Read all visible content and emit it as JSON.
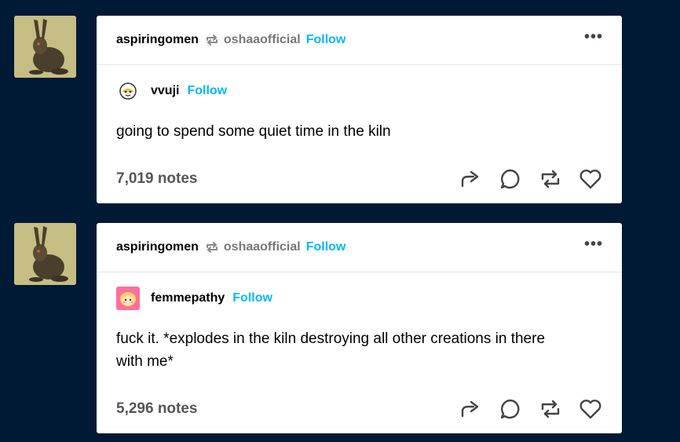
{
  "posts": [
    {
      "reblogger": "aspiringomen",
      "reblogged_from": "oshaaofficial",
      "follow_label": "Follow",
      "more_label": "•••",
      "source_user": "vvuji",
      "source_follow_label": "Follow",
      "body_lines": [
        "going to spend some quiet time in the kiln"
      ],
      "notes": "7,019 notes"
    },
    {
      "reblogger": "aspiringomen",
      "reblogged_from": "oshaaofficial",
      "follow_label": "Follow",
      "more_label": "•••",
      "source_user": "femmepathy",
      "source_follow_label": "Follow",
      "body_lines": [
        "fuck it. *explodes in the kiln destroying all other creations in there",
        "with me*"
      ],
      "notes": "5,296 notes"
    }
  ],
  "icons": {
    "share": "share-icon",
    "reply": "reply-icon",
    "reblog": "reblog-icon",
    "like": "heart-icon"
  },
  "colors": {
    "background": "#001935",
    "follow": "#00b8ff",
    "card": "#ffffff"
  }
}
